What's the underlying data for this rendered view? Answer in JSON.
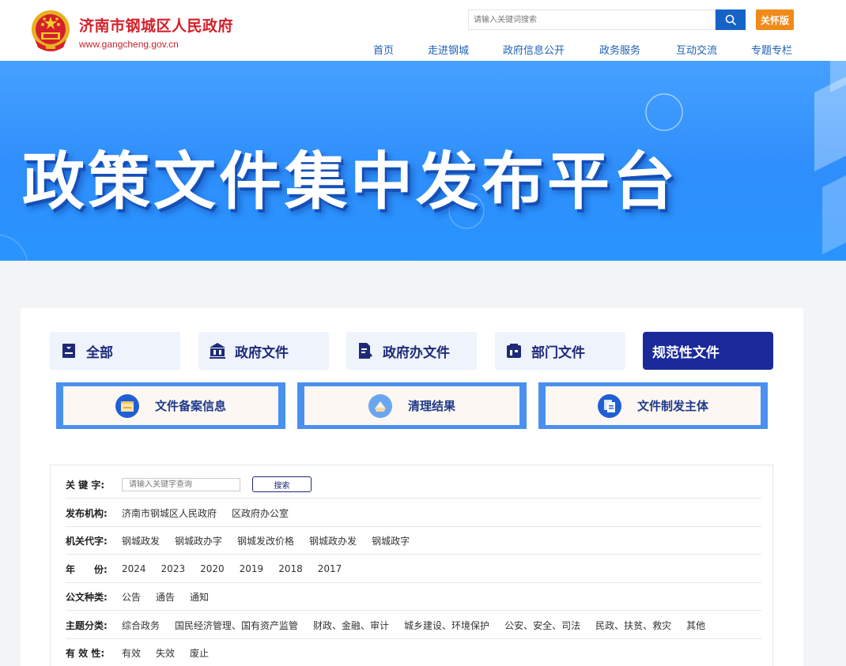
{
  "header": {
    "site_name": "济南市钢城区人民政府",
    "site_url": "www.gangcheng.gov.cn",
    "search_placeholder": "请输入关键词搜索",
    "care_label": "关怀版",
    "emblem_color": "#d4202a",
    "nav": [
      "首页",
      "走进钢城",
      "政府信息公开",
      "政务服务",
      "互动交流",
      "专题专栏"
    ]
  },
  "banner": {
    "title": "政策文件集中发布平台"
  },
  "tabs": [
    {
      "label": "全部",
      "icon": "document-icon"
    },
    {
      "label": "政府文件",
      "icon": "government-building-icon"
    },
    {
      "label": "政府办文件",
      "icon": "file-edit-icon"
    },
    {
      "label": "部门文件",
      "icon": "department-icon"
    },
    {
      "label": "规范性文件",
      "icon": "",
      "active": true
    }
  ],
  "sub_buttons": [
    {
      "label": "文件备案信息",
      "icon": "folder-icon"
    },
    {
      "label": "清理结果",
      "icon": "brush-icon"
    },
    {
      "label": "文件制发主体",
      "icon": "copy-document-icon"
    }
  ],
  "filter": {
    "keyword": {
      "label": "关 键 字:",
      "placeholder": "请输入关键字查询",
      "button": "搜索"
    },
    "rows": [
      {
        "label": "发布机构:",
        "options": [
          "济南市钢城区人民政府",
          "区政府办公室"
        ]
      },
      {
        "label": "机关代字:",
        "options": [
          "钢城政发",
          "钢城政办字",
          "钢城发改价格",
          "钢城政办发",
          "钢城政字"
        ]
      },
      {
        "label": "年　　份:",
        "options": [
          "2024",
          "2023",
          "2020",
          "2019",
          "2018",
          "2017"
        ]
      },
      {
        "label": "公文种类:",
        "options": [
          "公告",
          "通告",
          "通知"
        ]
      },
      {
        "label": "主题分类:",
        "options": [
          "综合政务",
          "国民经济管理、国有资产监管",
          "财政、金融、审计",
          "城乡建设、环境保护",
          "公安、安全、司法",
          "民政、扶贫、救灾",
          "其他"
        ]
      },
      {
        "label": "有 效 性:",
        "options": [
          "有效",
          "失效",
          "废止"
        ]
      }
    ]
  }
}
